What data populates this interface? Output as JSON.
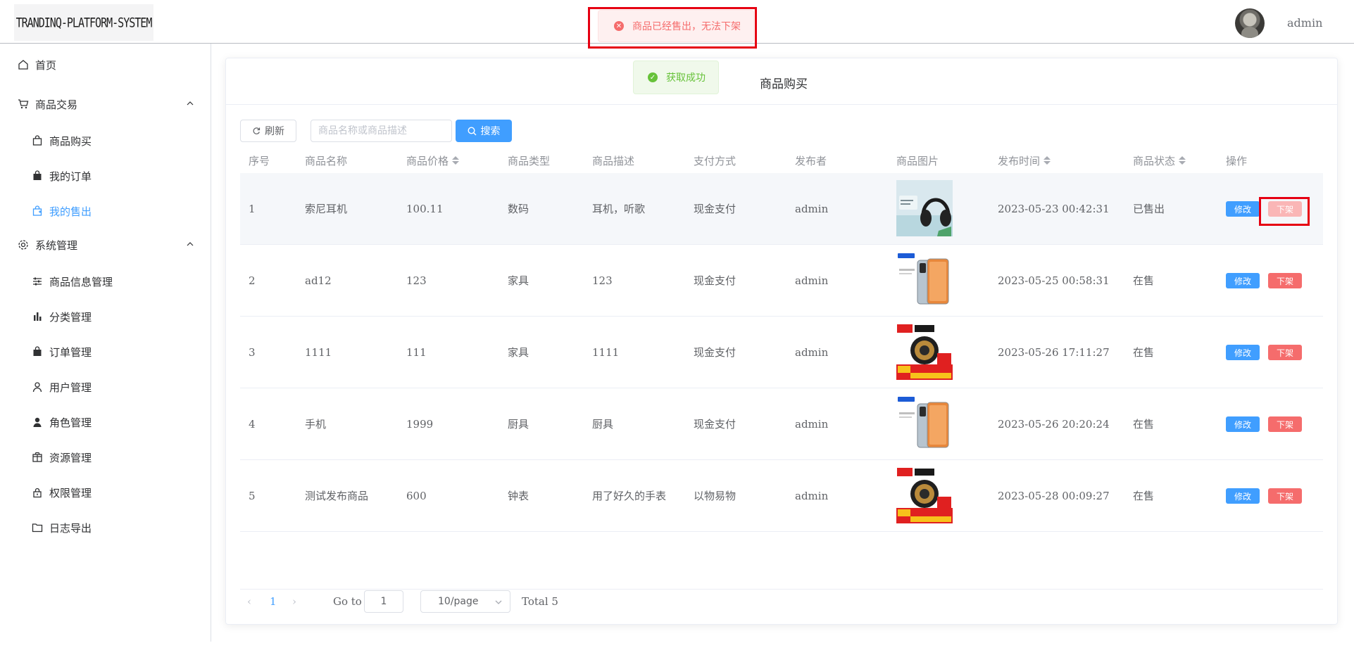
{
  "header": {
    "logo_text": "TRANDINQ-PLATFORM-SYSTEM",
    "username": "admin"
  },
  "sidebar": {
    "home": "首页",
    "trade_group": "商品交易",
    "trade_items": [
      "商品购买",
      "我的订单",
      "我的售出"
    ],
    "system_group": "系统管理",
    "system_items": [
      "商品信息管理",
      "分类管理",
      "订单管理",
      "用户管理",
      "角色管理",
      "资源管理",
      "权限管理",
      "日志导出"
    ]
  },
  "page": {
    "title": "商品购买",
    "refresh_label": "刷新",
    "search_placeholder": "商品名称或商品描述",
    "search_label": "搜索"
  },
  "table": {
    "columns": [
      "序号",
      "商品名称",
      "商品价格",
      "商品类型",
      "商品描述",
      "支付方式",
      "发布者",
      "商品图片",
      "发布时间",
      "商品状态",
      "操作"
    ],
    "edit_label": "修改",
    "off_label": "下架",
    "rows": [
      {
        "no": "1",
        "name": "索尼耳机",
        "price": "100.11",
        "type": "数码",
        "desc": "耳机，听歌",
        "pay": "现金支付",
        "publisher": "admin",
        "image": "headphones",
        "time": "2023-05-23 00:42:31",
        "status": "已售出"
      },
      {
        "no": "2",
        "name": "ad12",
        "price": "123",
        "type": "家具",
        "desc": "123",
        "pay": "现金支付",
        "publisher": "admin",
        "image": "phone",
        "time": "2023-05-25 00:58:31",
        "status": "在售"
      },
      {
        "no": "3",
        "name": "1111",
        "price": "111",
        "type": "家具",
        "desc": "1111",
        "pay": "现金支付",
        "publisher": "admin",
        "image": "watch",
        "time": "2023-05-26 17:11:27",
        "status": "在售"
      },
      {
        "no": "4",
        "name": "手机",
        "price": "1999",
        "type": "厨具",
        "desc": "厨具",
        "pay": "现金支付",
        "publisher": "admin",
        "image": "phone",
        "time": "2023-05-26 20:20:24",
        "status": "在售"
      },
      {
        "no": "5",
        "name": "测试发布商品",
        "price": "600",
        "type": "钟表",
        "desc": "用了好久的手表",
        "pay": "以物易物",
        "publisher": "admin",
        "image": "watch",
        "time": "2023-05-28 00:09:27",
        "status": "在售"
      }
    ]
  },
  "pagination": {
    "current_page": "1",
    "goto_label": "Go to",
    "goto_value": "1",
    "page_size": "10/page",
    "total": "Total 5"
  },
  "toasts": {
    "error": "商品已经售出，无法下架",
    "success": "获取成功"
  },
  "colors": {
    "primary": "#409eff",
    "danger": "#f56c6c",
    "success": "#67c23a",
    "highlight_frame": "#e60012"
  }
}
